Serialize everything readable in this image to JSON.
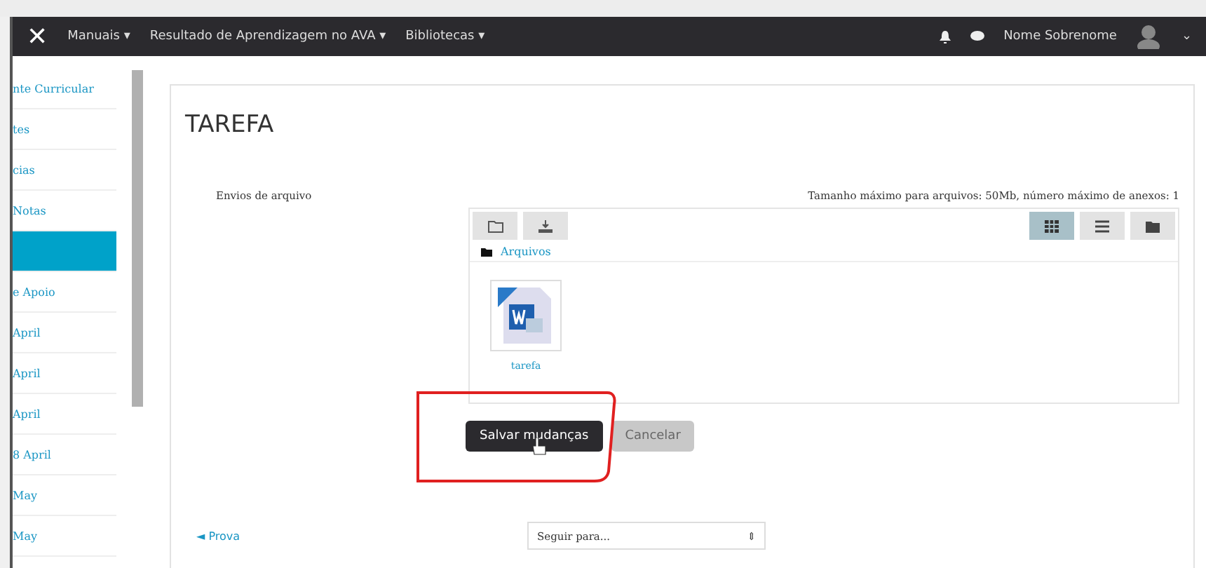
{
  "navbar": {
    "close": "✕",
    "menus": [
      {
        "label": "Manuais ▾"
      },
      {
        "label": "Resultado de Aprendizagem no AVA ▾"
      },
      {
        "label": "Bibliotecas ▾"
      }
    ],
    "user": "Nome Sobrenome",
    "user_caret": "⌄"
  },
  "sidebar": {
    "items": [
      {
        "label": "nte Curricular",
        "selected": false
      },
      {
        "label": "tes",
        "selected": false
      },
      {
        "label": "cias",
        "selected": false
      },
      {
        "label": "Notas",
        "selected": false
      },
      {
        "selected": true
      },
      {
        "label": "e Apoio",
        "selected": false
      },
      {
        "label": "April",
        "selected": false
      },
      {
        "label": "April",
        "selected": false
      },
      {
        "label": "April",
        "selected": false
      },
      {
        "label": "8 April",
        "selected": false
      },
      {
        "label": "May",
        "selected": false
      },
      {
        "label": "May",
        "selected": false
      }
    ]
  },
  "page": {
    "title": "TAREFA",
    "field_label": "Envios de arquivo",
    "limits": "Tamanho máximo para arquivos: 50Mb, número máximo de anexos: 1",
    "view_buttons": [
      {
        "kind": "grid",
        "selected": true
      },
      {
        "kind": "list",
        "selected": false
      },
      {
        "kind": "tree",
        "selected": false
      }
    ],
    "path": "Arquivos",
    "files": [
      {
        "name": "tarefa"
      }
    ],
    "buttons": [
      {
        "label": "Salvar mudanças",
        "kind": "primary"
      },
      {
        "label": "Cancelar",
        "kind": "secondary"
      }
    ],
    "prev_link": "◄ Prova",
    "jump": {
      "placeholder": "Seguir para...",
      "arrow": "⇕"
    }
  }
}
